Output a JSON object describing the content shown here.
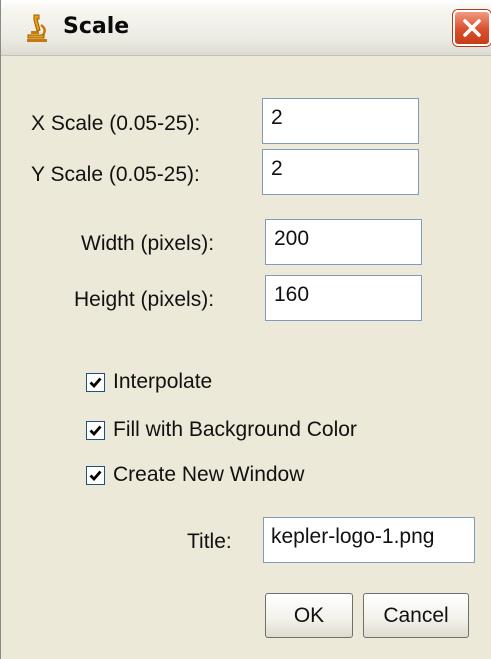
{
  "window": {
    "title": "Scale",
    "icons": {
      "app": "microscope-icon",
      "close": "close-icon"
    }
  },
  "form": {
    "x_scale": {
      "label": "X Scale (0.05-25):",
      "value": "2"
    },
    "y_scale": {
      "label": "Y Scale (0.05-25):",
      "value": "2"
    },
    "width": {
      "label": "Width (pixels):",
      "value": "200"
    },
    "height": {
      "label": "Height (pixels):",
      "value": "160"
    },
    "interpolate": {
      "label": "Interpolate",
      "checked": true
    },
    "fill_background": {
      "label": "Fill with Background Color",
      "checked": true
    },
    "create_window": {
      "label": "Create New Window",
      "checked": true
    },
    "title": {
      "label": "Title:",
      "value": "kepler-logo-1.png"
    }
  },
  "buttons": {
    "ok": "OK",
    "cancel": "Cancel"
  },
  "colors": {
    "dialog_bg": "#ece9d8",
    "field_border": "#7f9db9",
    "close_button": "#d8502a",
    "checkbox_border": "#1c5180"
  }
}
